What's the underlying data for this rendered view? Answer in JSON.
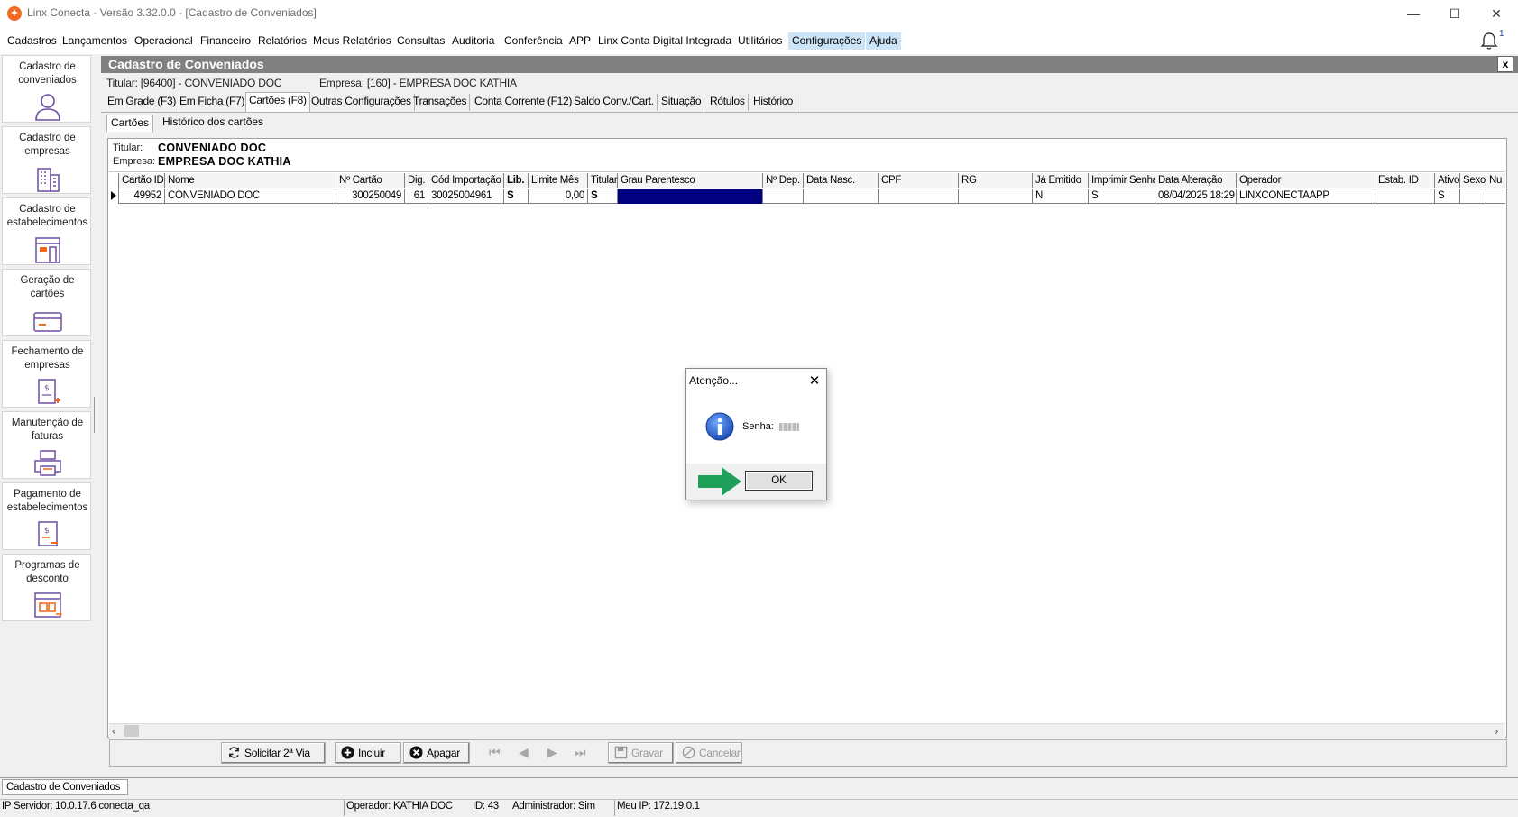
{
  "window": {
    "title": "Linx Conecta - Versão 3.32.0.0 - [Cadastro de Conveniados]",
    "minimize": "—",
    "maximize": "☐",
    "close": "✕"
  },
  "menu": [
    "Cadastros",
    "Lançamentos",
    "Operacional",
    "Financeiro",
    "Relatórios",
    "Meus Relatórios",
    "Consultas",
    "Auditoria",
    "Conferência",
    "APP",
    "Linx Conta Digital Integrada",
    "Utilitários",
    "Configurações",
    "Ajuda"
  ],
  "notifications": {
    "count": "1"
  },
  "sidebar": [
    {
      "label": "Cadastro de conveniados",
      "icon": "user-icon"
    },
    {
      "label": "Cadastro de empresas",
      "icon": "building-icon"
    },
    {
      "label": "Cadastro de estabelecimentos",
      "icon": "store-icon"
    },
    {
      "label": "Geração de cartões",
      "icon": "card-icon"
    },
    {
      "label": "Fechamento de empresas",
      "icon": "invoice-close-icon"
    },
    {
      "label": "Manutenção de faturas",
      "icon": "printer-icon"
    },
    {
      "label": "Pagamento de estabelecimentos",
      "icon": "payment-icon"
    },
    {
      "label": "Programas de desconto",
      "icon": "discount-program-icon"
    }
  ],
  "panel": {
    "title": "Cadastro de Conveniados",
    "close": "x",
    "titular_info": "Titular: [96400] - CONVENIADO DOC",
    "empresa_info": "Empresa: [160] - EMPRESA DOC KATHIA"
  },
  "tabs": [
    "Em Grade (F3)",
    "Em Ficha (F7)",
    "Cartões (F8)",
    "Outras Configurações",
    "Transações",
    "Conta Corrente (F12)",
    "Saldo Conv./Cart.",
    "Situação",
    "Rótulos",
    "Histórico"
  ],
  "subtabs": [
    "Cartões",
    "Histórico dos cartões"
  ],
  "owner": {
    "titular_label": "Titular:",
    "titular_value": "CONVENIADO DOC",
    "empresa_label": "Empresa:",
    "empresa_value": "EMPRESA DOC KATHIA"
  },
  "grid": {
    "columns": [
      "Cartão ID",
      "Nome",
      "Nº Cartão",
      "Dig.",
      "Cód Importação",
      "Lib.",
      "Limite Mês",
      "Titular",
      "Grau Parentesco",
      "Nº Dep.",
      "Data Nasc.",
      "CPF",
      "RG",
      "Já Emitido",
      "Imprimir Senha",
      "Data Alteração",
      "Operador",
      "Estab. ID",
      "Ativo",
      "Sexo",
      "Nu"
    ],
    "rows": [
      [
        "49952",
        "CONVENIADO DOC",
        "300250049",
        "61",
        "30025004961",
        "S",
        "0,00",
        "S",
        "",
        "",
        "",
        "",
        "",
        "N",
        "S",
        "08/04/2025 18:29",
        "LINXCONECTAAPP",
        "",
        "S",
        "",
        ""
      ]
    ],
    "selected_color": "#000080"
  },
  "toolbar": {
    "solicitar": "Solicitar 2ª Via",
    "incluir": "Incluir",
    "apagar": "Apagar",
    "gravar": "Gravar",
    "cancelar": "Cancelar"
  },
  "status": {
    "form": "Cadastro de Conveniados",
    "ip_servidor": "IP Servidor: 10.0.17.6 conecta_qa",
    "operador": "Operador: KATHIA DOC",
    "id": "ID: 43",
    "administrador": "Administrador: Sim",
    "meu_ip": "Meu IP: 172.19.0.1"
  },
  "dialog": {
    "title": "Atenção...",
    "message": "Senha:",
    "ok": "OK",
    "icon": "info-icon"
  },
  "colors": {
    "accent": "#f26a21",
    "header": "#808080",
    "menu_highlight": "#cce4f7",
    "arrow": "#1ea05a",
    "icon_purple": "#6b4fa0"
  }
}
